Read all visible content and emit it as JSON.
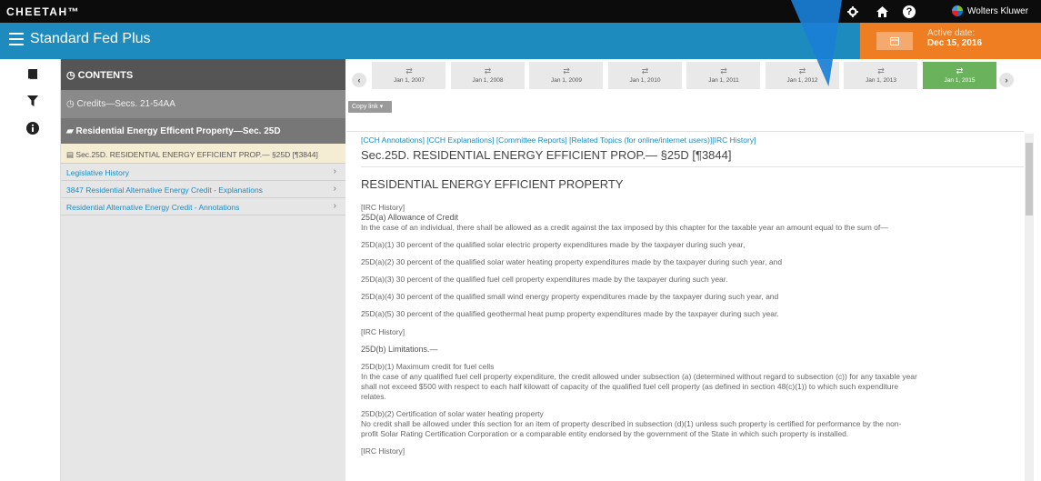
{
  "topbar": {
    "brand": "CHEETAH™",
    "settings_icon": "gear-icon",
    "home_icon": "home-icon",
    "help_icon": "question-icon",
    "publisher": "Wolters Kluwer"
  },
  "appbar": {
    "title": "Standard Fed Plus",
    "active_date_label": "Active date:",
    "active_date_value": "Dec 15, 2016",
    "accent": "#ef7d22",
    "bar_color": "#1d8bbe"
  },
  "rail": [
    "book-icon",
    "filter-icon",
    "info-icon"
  ],
  "toc": {
    "contents": "CONTENTS",
    "parent": "Credits—Secs. 21-54AA",
    "section": "Residential Energy Efficent Property—Sec. 25D",
    "current": "Sec.25D. RESIDENTIAL ENERGY EFFICIENT PROP.— §25D [¶3844]",
    "items": [
      "Legislative History",
      "3847 Residential Alternative Energy Credit - Explanations",
      "Residential Alternative Energy Credit - Annotations"
    ]
  },
  "timeline": {
    "dates": [
      "Jan 1, 2007",
      "Jan 1, 2008",
      "Jan 1, 2009",
      "Jan 1, 2010",
      "Jan 1, 2011",
      "Jan 1, 2012",
      "Jan 1, 2013",
      "Jan 1, 2015"
    ],
    "selected": "Jan 1, 2015",
    "selected_color": "#6ab35c",
    "copy_link": "Copy link ▾"
  },
  "document": {
    "links": "[CCH Annotations] [CCH Explanations] [Committee Reports] [Related Topics (for online/internet users)][IRC History]",
    "section_title": "Sec.25D. RESIDENTIAL ENERGY EFFICIENT PROP.— §25D [¶3844]",
    "heading": "RESIDENTIAL ENERGY EFFICIENT PROPERTY",
    "irc_history": "[IRC History]",
    "a_title": "25D(a) Allowance of Credit",
    "a_text": "In the case of an individual, there shall be allowed as a credit against the tax imposed by this chapter for the taxable year an amount equal to the sum of—",
    "a1": "25D(a)(1) 30 percent of the qualified solar electric property expenditures made by the taxpayer during such year,",
    "a2": "25D(a)(2) 30 percent of the qualified solar water heating property expenditures made by the taxpayer during such year, and",
    "a3": "25D(a)(3) 30 percent of the qualified fuel cell property expenditures made by the taxpayer during such year.",
    "a4": "25D(a)(4) 30 percent of the qualified small wind energy property expenditures made by the taxpayer during such year, and",
    "a5": "25D(a)(5) 30 percent of the qualified geothermal heat pump property expenditures made by the taxpayer during such year.",
    "irc_history_2": "[IRC History]",
    "b_title": "25D(b) Limitations.—",
    "b1_title": "25D(b)(1) Maximum credit for fuel cells",
    "b1_text_1": "In the case of any qualified fuel cell property expenditure, the credit allowed under subsection (a) (determined without regard to subsection (c)) for any taxable year",
    "b1_text_2": "shall not exceed $500 with respect to each half kilowatt of capacity of the qualified fuel cell property (as defined in section 48(c)(1)) to which such expenditure",
    "b1_text_3": "relates.",
    "b2_title": "25D(b)(2) Certification of solar water heating property",
    "b2_text_1": "No credit shall be allowed under this section for an item of property described in subsection (d)(1) unless such property is certified for performance by the non-",
    "b2_text_2": "profit Solar Rating Certification Corporation or a comparable entity endorsed by the government of the State in which such property is installed.",
    "irc_history_3": "[IRC History]"
  }
}
